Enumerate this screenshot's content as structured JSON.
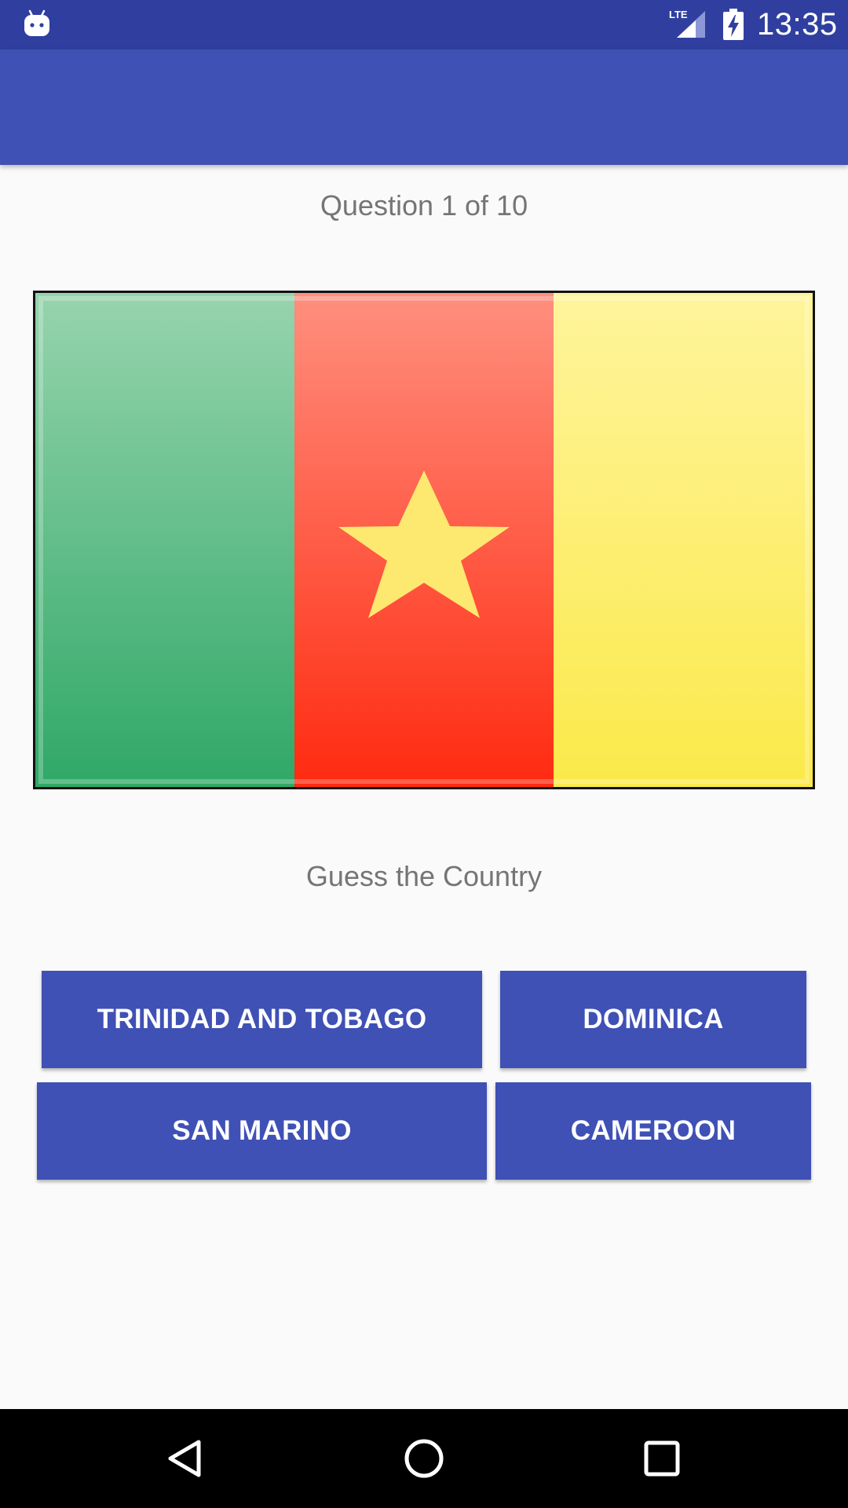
{
  "status_bar": {
    "time": "13:35",
    "network_label": "LTE",
    "icons": [
      "android-icon",
      "lte-signal-icon",
      "battery-charging-icon"
    ]
  },
  "quiz": {
    "question_counter": "Question 1 of 10",
    "prompt": "Guess the Country",
    "flag_icon": "cameroon-flag",
    "answers": [
      "TRINIDAD AND TOBAGO",
      "DOMINICA",
      "SAN MARINO",
      "CAMEROON"
    ]
  },
  "colors": {
    "status_bar": "#303f9f",
    "app_bar": "#3f51b5",
    "button": "#3f51b5",
    "background": "#fafafa",
    "text_secondary": "#757575",
    "flag_green": "#2fa866",
    "flag_red": "#ff2a10",
    "flag_yellow": "#fbe94a",
    "flag_star": "#fde870"
  },
  "nav_bar": {
    "icons": [
      "back-icon",
      "home-icon",
      "recents-icon"
    ]
  }
}
